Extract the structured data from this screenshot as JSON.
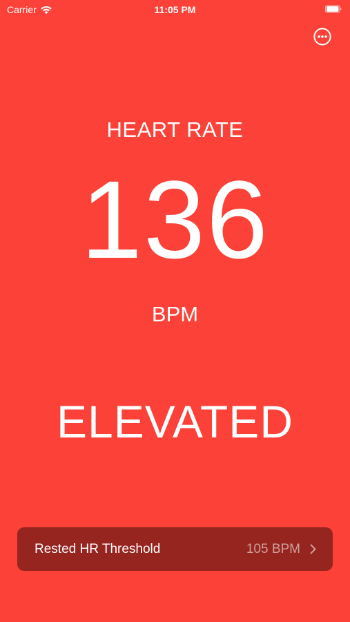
{
  "status_bar": {
    "carrier": "Carrier",
    "time": "11:05 PM",
    "icons": [
      "wifi-icon",
      "battery-icon"
    ]
  },
  "toolbar": {
    "more_icon": "ellipsis-circle-icon"
  },
  "heart_rate": {
    "label": "HEART RATE",
    "value": "136",
    "unit": "BPM",
    "status": "ELEVATED"
  },
  "threshold": {
    "label": "Rested HR Threshold",
    "value": "105 BPM",
    "chevron_icon": "chevron-right-icon"
  },
  "colors": {
    "background": "#fb4138",
    "row_background": "#96241f",
    "text": "#ffffff",
    "secondary_text": "#cfa19d"
  }
}
